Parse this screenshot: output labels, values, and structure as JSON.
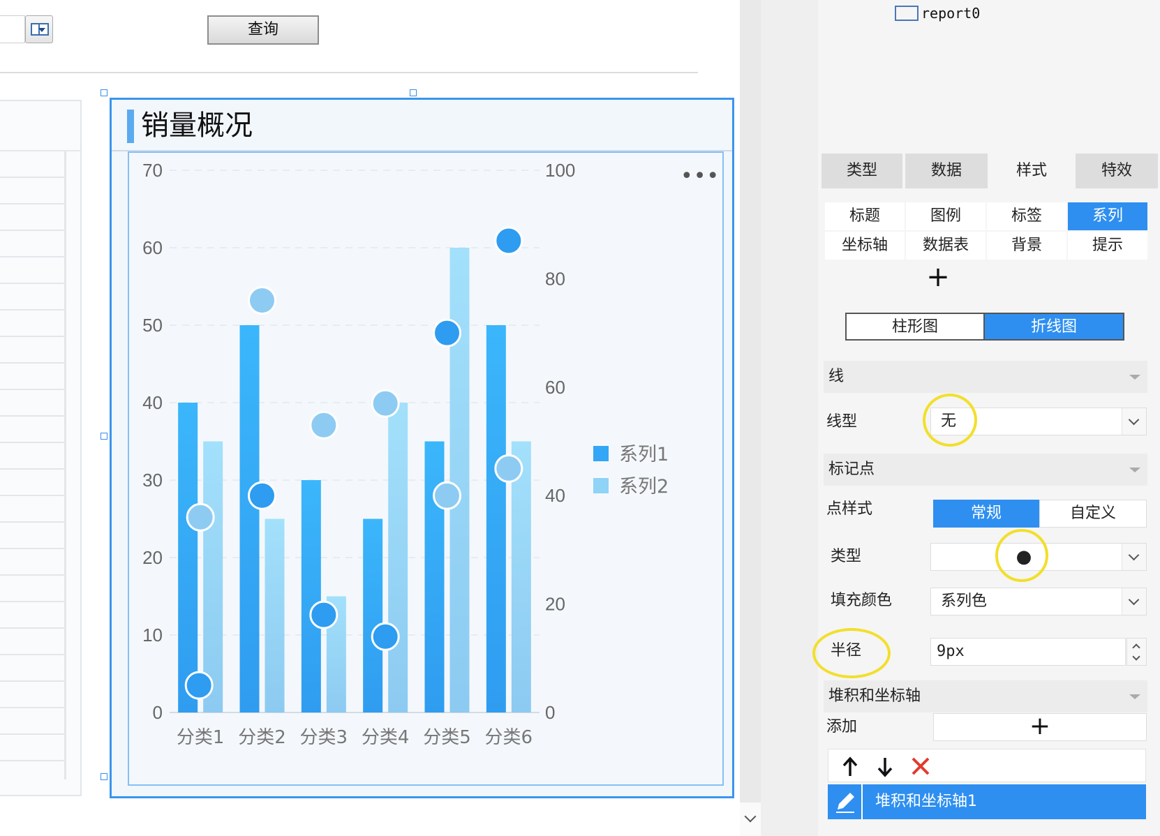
{
  "toolbar": {
    "query_label": "查询"
  },
  "chart": {
    "title": "销量概况",
    "more_icon": "more-icon"
  },
  "chart_data": {
    "type": "bar",
    "categories": [
      "分类1",
      "分类2",
      "分类3",
      "分类4",
      "分类5",
      "分类6"
    ],
    "series": [
      {
        "name": "系列1",
        "type": "bar",
        "axis": "left",
        "color": "#33a6f5",
        "values": [
          40,
          50,
          30,
          25,
          35,
          50
        ]
      },
      {
        "name": "系列2",
        "type": "bar",
        "axis": "left",
        "color": "#8fd3f6",
        "values": [
          35,
          25,
          15,
          40,
          60,
          35
        ]
      },
      {
        "type": "line",
        "axis": "right",
        "color": "#2e9cf0",
        "line": "none",
        "values": [
          5,
          40,
          18,
          14,
          70,
          87
        ]
      },
      {
        "type": "line",
        "axis": "right",
        "color": "#8ecbf2",
        "line": "none",
        "values": [
          36,
          76,
          53,
          57,
          40,
          45
        ]
      }
    ],
    "y_left": {
      "min": 0,
      "max": 70,
      "ticks": [
        0,
        10,
        20,
        30,
        40,
        50,
        60,
        70
      ]
    },
    "y_right": {
      "min": 0,
      "max": 100,
      "ticks": [
        0,
        20,
        40,
        60,
        80,
        100
      ]
    },
    "legend": {
      "position": "right",
      "items": [
        "系列1",
        "系列2"
      ]
    },
    "grid": "dashed-horizontal"
  },
  "tree": {
    "item_label": "report0"
  },
  "props": {
    "main_tabs": [
      "类型",
      "数据",
      "样式",
      "特效"
    ],
    "main_tab_active": "样式",
    "sub_tabs": [
      "标题",
      "图例",
      "标签",
      "系列",
      "坐标轴",
      "数据表",
      "背景",
      "提示"
    ],
    "sub_tab_active": "系列",
    "add_label": "+",
    "chart_kind": {
      "options": [
        "柱形图",
        "折线图"
      ],
      "active": "折线图"
    },
    "line_section": {
      "title": "线",
      "line_type_label": "线型",
      "line_type_value": "无"
    },
    "marker_section": {
      "title": "标记点",
      "point_style_label": "点样式",
      "point_style_options": [
        "常规",
        "自定义"
      ],
      "point_style_active": "常规",
      "type_label": "类型",
      "type_value": "●",
      "fill_label": "填充颜色",
      "fill_value": "系列色",
      "radius_label": "半径",
      "radius_value": "9px"
    },
    "stack_section": {
      "title": "堆积和坐标轴",
      "add_label": "添加",
      "add_icon": "+",
      "row_label": "堆积和坐标轴1"
    }
  }
}
